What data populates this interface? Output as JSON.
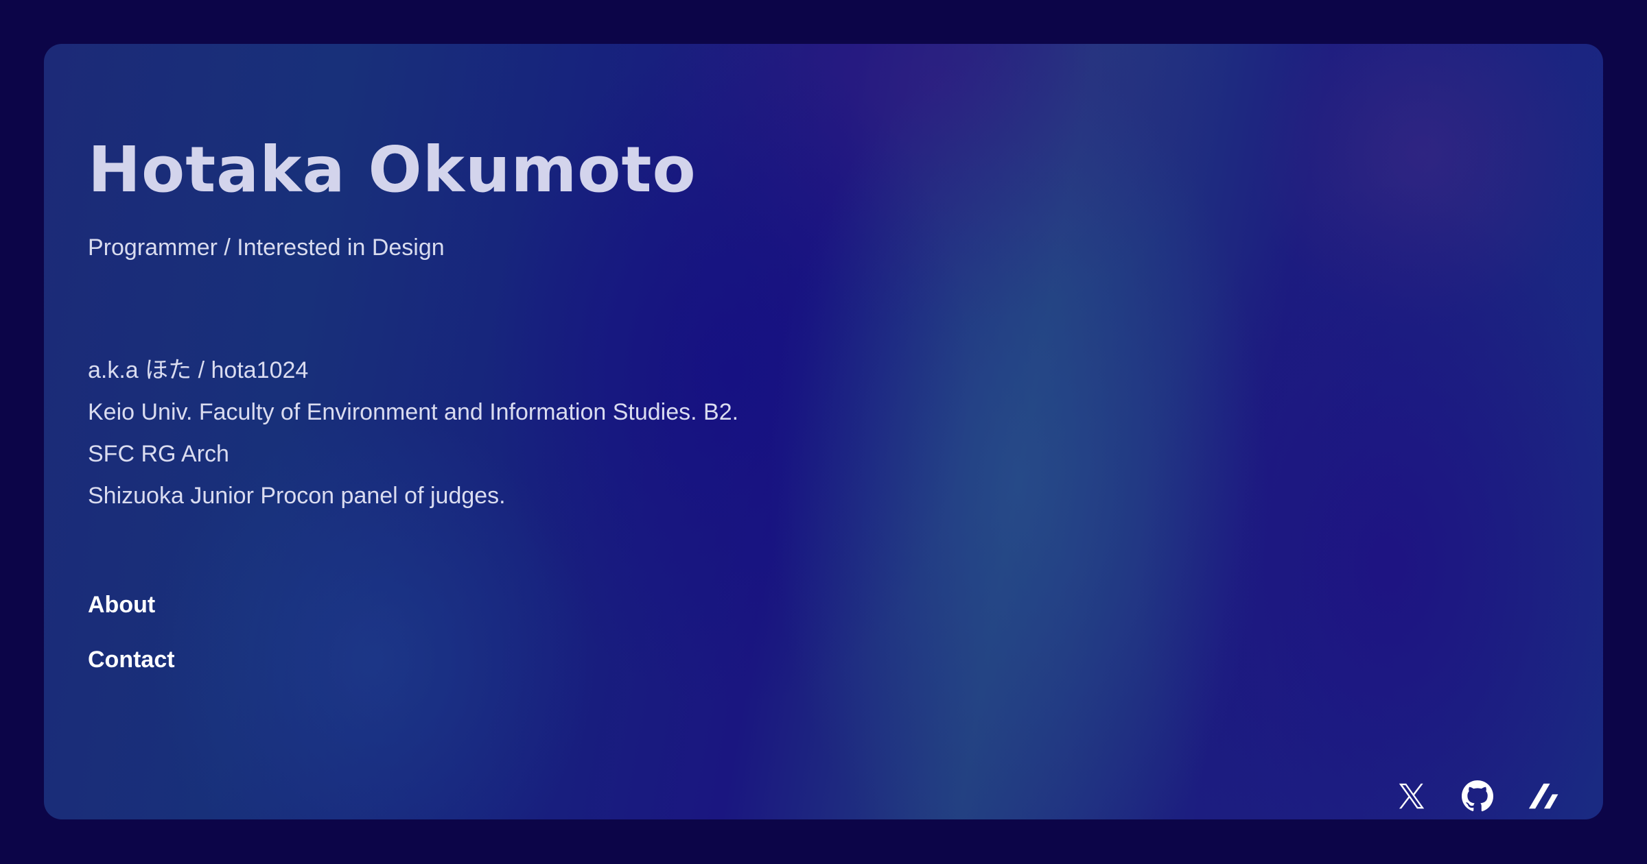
{
  "profile": {
    "name": "Hotaka Okumoto",
    "tagline": "Programmer / Interested in Design"
  },
  "bio": [
    "a.k.a ほた / hota1024",
    "Keio Univ. Faculty of Environment and Information Studies. B2.",
    "SFC RG Arch",
    "Shizuoka Junior Procon panel of judges."
  ],
  "nav": {
    "about_label": "About",
    "contact_label": "Contact"
  },
  "socials": [
    {
      "icon": "x-icon"
    },
    {
      "icon": "github-icon"
    },
    {
      "icon": "zenn-icon"
    }
  ],
  "colors": {
    "background": "#0c0548",
    "text": "#dadcf0",
    "link": "#ffffff"
  }
}
